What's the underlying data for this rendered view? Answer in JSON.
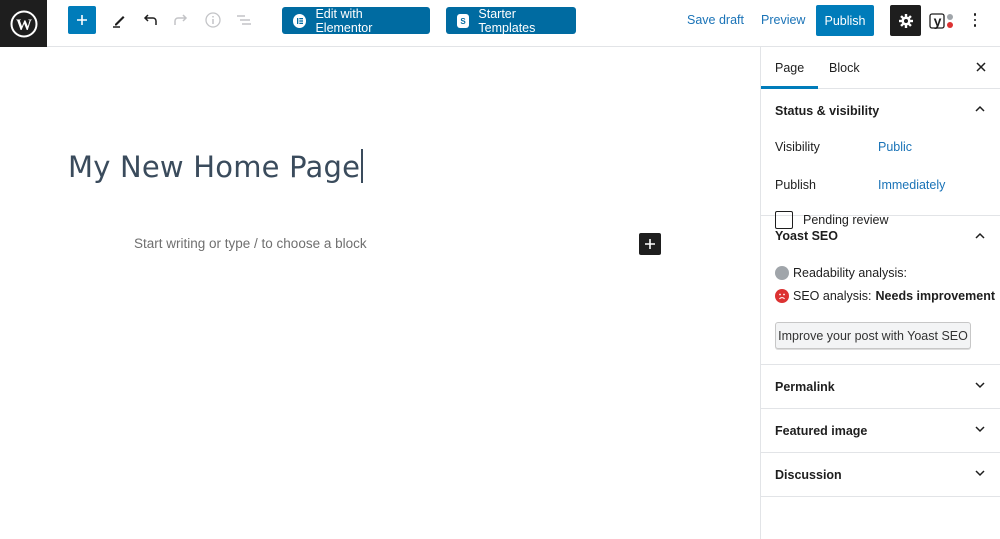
{
  "toolbar": {
    "logo_icon": "wordpress-logo-icon",
    "inserter_icon": "plus-icon",
    "tools_icon": "pencil-icon",
    "undo_icon": "undo-icon",
    "redo_icon": "redo-icon",
    "info_icon": "info-icon",
    "outline_icon": "list-view-icon",
    "elementor_label": "Edit with Elementor",
    "starter_label": "Starter Templates",
    "save_draft_label": "Save draft",
    "preview_label": "Preview",
    "publish_label": "Publish",
    "settings_icon": "gear-icon",
    "yoast_icon": "yoast-icon",
    "more_icon": "kebab-menu-icon"
  },
  "editor": {
    "title": "My New Home Page",
    "placeholder": "Start writing or type / to choose a block"
  },
  "sidebar": {
    "tabs": [
      {
        "label": "Page",
        "active": true
      },
      {
        "label": "Block",
        "active": false
      }
    ],
    "status_visibility": {
      "heading": "Status & visibility",
      "visibility_label": "Visibility",
      "visibility_value": "Public",
      "publish_label": "Publish",
      "publish_value": "Immediately",
      "pending_label": "Pending review",
      "pending_checked": false
    },
    "yoast": {
      "heading": "Yoast SEO",
      "readability_label": "Readability analysis:",
      "seo_label": "SEO analysis:",
      "seo_value": "Needs improvement",
      "improve_button": "Improve your post with Yoast SEO"
    },
    "panels": [
      {
        "label": "Permalink"
      },
      {
        "label": "Featured image"
      },
      {
        "label": "Discussion"
      }
    ]
  },
  "colors": {
    "accent": "#007cba",
    "dark": "#1e1e1e",
    "link": "#1a73b7",
    "seo_bad": "#dc3232",
    "readability_none": "#a0a5aa"
  }
}
